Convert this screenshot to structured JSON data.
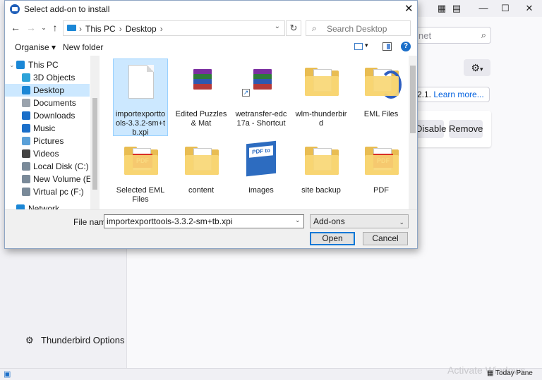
{
  "background": {
    "search_placeholder_fragment": "net",
    "notice_prefix": "2.1.",
    "notice_link": "Learn more...",
    "disable_label": "Disable",
    "remove_label": "Remove",
    "options_label": "Thunderbird Options",
    "watermark": "Activate Windows",
    "today_pane_label": "Today Pane"
  },
  "dialog": {
    "title": "Select add-on to install",
    "close_glyph": "✕",
    "breadcrumbs": [
      "This PC",
      "Desktop"
    ],
    "search_placeholder": "Search Desktop",
    "toolbar": {
      "organise": "Organise ▾",
      "new_folder": "New folder",
      "help": "?"
    },
    "nav_items": [
      {
        "label": "This PC",
        "icon": "pc-icon",
        "color": "#1b87d6"
      },
      {
        "label": "3D Objects",
        "icon": "cube-icon",
        "color": "#2ea3d8"
      },
      {
        "label": "Desktop",
        "icon": "desktop-icon",
        "color": "#1b87d6",
        "selected": true
      },
      {
        "label": "Documents",
        "icon": "documents-icon",
        "color": "#9aa3ad"
      },
      {
        "label": "Downloads",
        "icon": "download-icon",
        "color": "#1b6fc9"
      },
      {
        "label": "Music",
        "icon": "music-icon",
        "color": "#1b6fc9"
      },
      {
        "label": "Pictures",
        "icon": "pictures-icon",
        "color": "#5aa0d8"
      },
      {
        "label": "Videos",
        "icon": "videos-icon",
        "color": "#444"
      },
      {
        "label": "Local Disk (C:)",
        "icon": "drive-icon",
        "color": "#7a8a99"
      },
      {
        "label": "New Volume (E:)",
        "icon": "drive-icon",
        "color": "#7a8a99"
      },
      {
        "label": "Virtual pc (F:)",
        "icon": "drive-icon",
        "color": "#7a8a99"
      },
      {
        "label": "Network",
        "icon": "network-icon",
        "color": "#1b87d6"
      }
    ],
    "files": [
      {
        "label": "importexporttools-3.3.2-sm+tb.xpi",
        "kind": "doc",
        "selected": true
      },
      {
        "label": "Edited Puzzles & Mat",
        "kind": "rar"
      },
      {
        "label": "wetransfer-edc17a - Shortcut",
        "kind": "rar-shortcut"
      },
      {
        "label": "wlm-thunderbird",
        "kind": "folder"
      },
      {
        "label": "EML Files",
        "kind": "folder-blue"
      },
      {
        "label": "Selected EML Files",
        "kind": "folder-pdf"
      },
      {
        "label": "content",
        "kind": "folder"
      },
      {
        "label": "images",
        "kind": "pdf-book"
      },
      {
        "label": "site backup",
        "kind": "folder"
      },
      {
        "label": "PDF",
        "kind": "folder-pdf"
      }
    ],
    "file_name_label": "File name:",
    "file_name_value": "importexporttools-3.3.2-sm+tb.xpi",
    "file_type_value": "Add-ons",
    "open_label": "Open",
    "cancel_label": "Cancel",
    "pdf_badge": "PDF",
    "pdf_book_text": "PDF to"
  }
}
